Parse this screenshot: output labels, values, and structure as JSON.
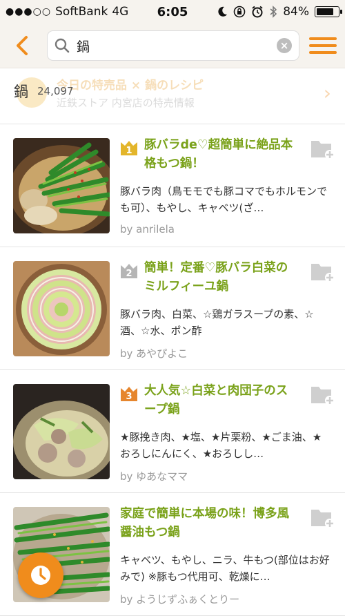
{
  "status_bar": {
    "signal": "●●●○○",
    "carrier": "SoftBank",
    "network": "4G",
    "time": "6:05",
    "battery_percent": "84%",
    "battery_level": 0.84
  },
  "header": {
    "search_query": "鍋",
    "back_icon": "chevron-left-icon",
    "search_icon": "magnifier-icon",
    "clear_icon": "clear-x-icon",
    "menu_icon": "hamburger-menu-icon",
    "accent_color": "#f08c1c"
  },
  "summary": {
    "keyword": "鍋",
    "count": "24,097",
    "promo_line1": "今日の特売品 × 鍋のレシピ",
    "promo_line2": "近鉄ストア 内宮店の特売情報"
  },
  "recipes": [
    {
      "rank": "1",
      "title": "豚バラde♡超簡単に絶品本格もつ鍋！",
      "ingredients": "豚バラ肉（鳥モモでも豚コマでもホルモンでも可）、もやし、キャベツ(ざ…",
      "author": "by anrilela"
    },
    {
      "rank": "2",
      "title": "簡単！定番♡豚バラ白菜のミルフィーユ鍋",
      "ingredients": "豚バラ肉、白菜、☆鶏ガラスープの素、☆酒、☆水、ポン酢",
      "author": "by あやぴよこ"
    },
    {
      "rank": "3",
      "title": "大人気☆白菜と肉団子のスープ鍋",
      "ingredients": "★豚挽き肉、★塩、★片栗粉、★ごま油、★おろしにんにく、★おろしし…",
      "author": "by ゆあなママ"
    },
    {
      "rank": "",
      "title": "家庭で簡単に本場の味！博多風 醤油もつ鍋",
      "ingredients": "キャベツ、もやし、ニラ、牛もつ(部位はお好みで) ※豚もつ代用可、乾燥に…",
      "author": "by ようじずふぁくとりー"
    }
  ],
  "colors": {
    "title_green": "#7aa21a",
    "gold": "#e3b52a",
    "silver": "#b5b5b5",
    "bronze": "#e6862e"
  },
  "fab_icon": "clock-history-icon"
}
